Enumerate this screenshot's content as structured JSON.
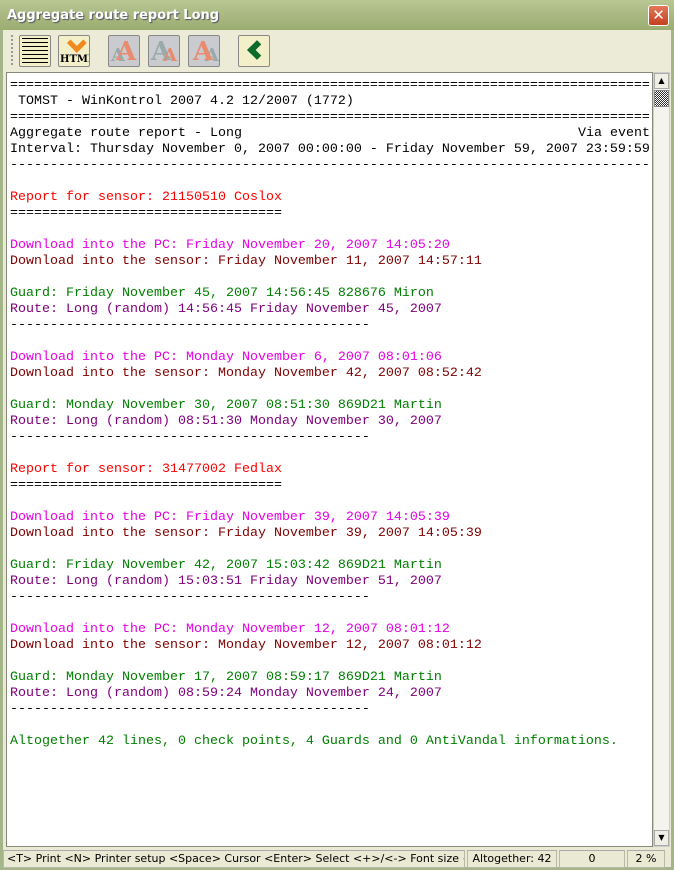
{
  "window": {
    "title": "Aggregate route report Long",
    "close": "✕"
  },
  "toolbar": {
    "icons": [
      "detailed-report-icon",
      "export-html-icon",
      "font-default-icon",
      "font-smaller-icon",
      "font-larger-icon",
      "back-icon"
    ],
    "html_label": "HTML"
  },
  "colors": {
    "black": "#000000",
    "red": "#ff0000",
    "magenta": "#e600e6",
    "darkred": "#800000",
    "green": "#008000",
    "purple": "#800080"
  },
  "report": {
    "lines": [
      {
        "t": "================================================================================",
        "c": "black"
      },
      {
        "t": " TOMST - WinKontrol 2007 4.2 12/2007 (1772)",
        "c": "black"
      },
      {
        "t": "================================================================================",
        "c": "black"
      },
      {
        "t": "Aggregate route report - Long",
        "r": "Via event",
        "c": "black"
      },
      {
        "t": "Interval: Thursday November 0, 2007 00:00:00 - Friday November 59, 2007 23:59:59",
        "c": "black"
      },
      {
        "t": "--------------------------------------------------------------------------------",
        "c": "black"
      },
      {
        "t": "",
        "c": "black"
      },
      {
        "t": "Report for sensor: 21150510 Coslox",
        "c": "red"
      },
      {
        "t": "==================================",
        "c": "black"
      },
      {
        "t": "",
        "c": "black"
      },
      {
        "t": "Download into the PC: Friday November 20, 2007 14:05:20",
        "c": "magenta"
      },
      {
        "t": "Download into the sensor: Friday November 11, 2007 14:57:11",
        "c": "darkred"
      },
      {
        "t": "",
        "c": "black"
      },
      {
        "t": "Guard: Friday November 45, 2007 14:56:45 828676 Miron",
        "c": "green"
      },
      {
        "t": "Route: Long (random) 14:56:45 Friday November 45, 2007",
        "c": "purple"
      },
      {
        "t": "---------------------------------------------",
        "c": "black"
      },
      {
        "t": "",
        "c": "black"
      },
      {
        "t": "Download into the PC: Monday November 6, 2007 08:01:06",
        "c": "magenta"
      },
      {
        "t": "Download into the sensor: Monday November 42, 2007 08:52:42",
        "c": "darkred"
      },
      {
        "t": "",
        "c": "black"
      },
      {
        "t": "Guard: Monday November 30, 2007 08:51:30 869D21 Martin",
        "c": "green"
      },
      {
        "t": "Route: Long (random) 08:51:30 Monday November 30, 2007",
        "c": "purple"
      },
      {
        "t": "---------------------------------------------",
        "c": "black"
      },
      {
        "t": "",
        "c": "black"
      },
      {
        "t": "Report for sensor: 31477002 Fedlax",
        "c": "red"
      },
      {
        "t": "==================================",
        "c": "black"
      },
      {
        "t": "",
        "c": "black"
      },
      {
        "t": "Download into the PC: Friday November 39, 2007 14:05:39",
        "c": "magenta"
      },
      {
        "t": "Download into the sensor: Friday November 39, 2007 14:05:39",
        "c": "darkred"
      },
      {
        "t": "",
        "c": "black"
      },
      {
        "t": "Guard: Friday November 42, 2007 15:03:42 869D21 Martin",
        "c": "green"
      },
      {
        "t": "Route: Long (random) 15:03:51 Friday November 51, 2007",
        "c": "purple"
      },
      {
        "t": "---------------------------------------------",
        "c": "black"
      },
      {
        "t": "",
        "c": "black"
      },
      {
        "t": "Download into the PC: Monday November 12, 2007 08:01:12",
        "c": "magenta"
      },
      {
        "t": "Download into the sensor: Monday November 12, 2007 08:01:12",
        "c": "darkred"
      },
      {
        "t": "",
        "c": "black"
      },
      {
        "t": "Guard: Monday November 17, 2007 08:59:17 869D21 Martin",
        "c": "green"
      },
      {
        "t": "Route: Long (random) 08:59:24 Monday November 24, 2007",
        "c": "purple"
      },
      {
        "t": "---------------------------------------------",
        "c": "black"
      },
      {
        "t": "",
        "c": "black"
      },
      {
        "t": "Altogether 42 lines, 0 check points, 4 Guards and 0 AntiVandal informations.",
        "c": "green"
      }
    ]
  },
  "status": {
    "hints": "<T> Print <N> Printer setup <Space> Cursor <Enter> Select <+>/<-> Font size <S> Restore",
    "total": "Altogether: 42",
    "position": "0",
    "percent": "2 %"
  }
}
